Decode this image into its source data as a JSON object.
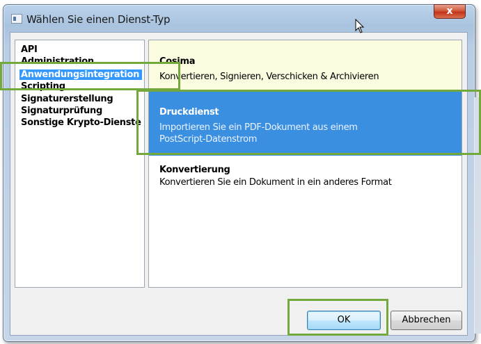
{
  "window": {
    "title": "Wählen Sie einen Dienst-Typ",
    "close_label": "x"
  },
  "categories": [
    {
      "label": "API",
      "selected": false
    },
    {
      "label": "Administration",
      "selected": false
    },
    {
      "label": "Anwendungsintegration",
      "selected": true
    },
    {
      "label": "Scripting",
      "selected": false
    },
    {
      "label": "Signaturerstellung",
      "selected": false
    },
    {
      "label": "Signaturprüfung",
      "selected": false
    },
    {
      "label": "Sonstige Krypto-Dienste",
      "selected": false
    }
  ],
  "services": [
    {
      "title": "Cosima",
      "description": "Konvertieren, Signieren, Verschicken & Archivieren",
      "state": "hover"
    },
    {
      "title": "Druckdienst",
      "description": "Importieren Sie ein PDF-Dokument aus einem PostScript-Datenstrom",
      "state": "selected"
    },
    {
      "title": "Konvertierung",
      "description": "Konvertieren Sie ein Dokument in ein anderes Format",
      "state": "normal"
    }
  ],
  "buttons": {
    "ok_label": "OK",
    "cancel_label": "Abbrechen"
  },
  "colors": {
    "selection": "#3399ff",
    "service_selected": "#3a8fe0",
    "service_hover": "#fcfce0",
    "highlight_outline": "#72a83c"
  }
}
